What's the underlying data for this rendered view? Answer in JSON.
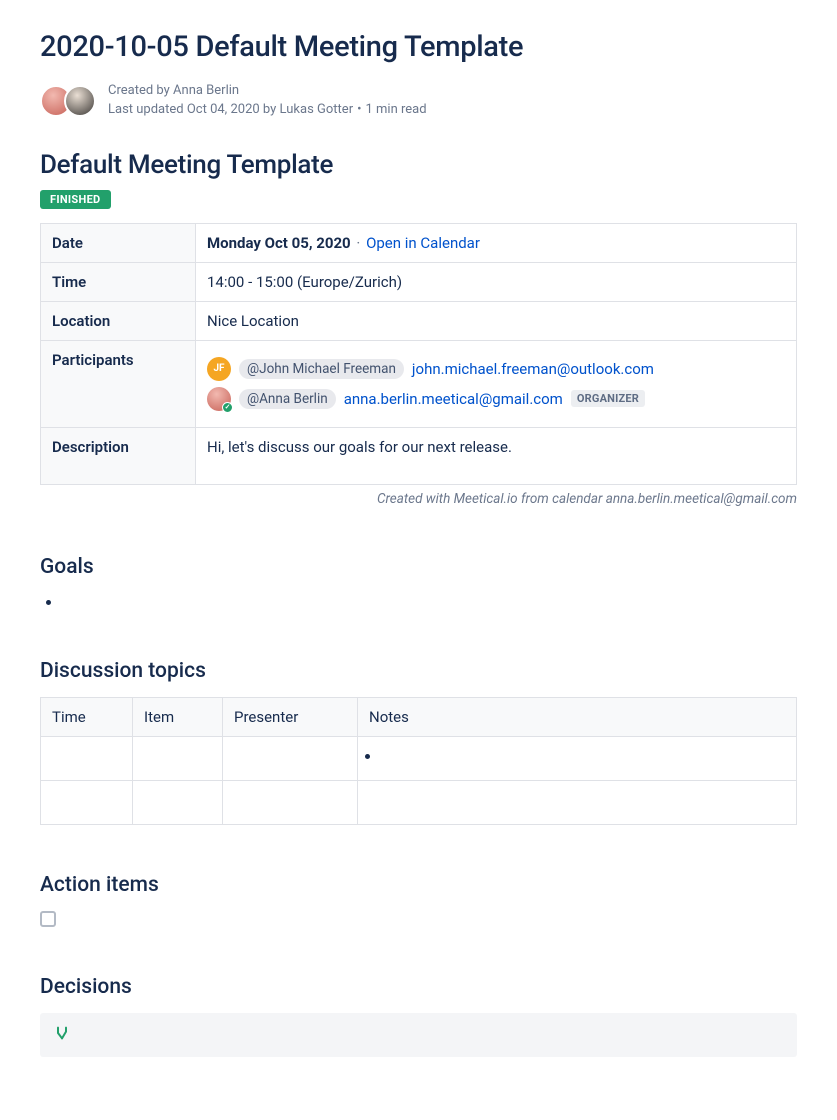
{
  "page": {
    "title": "2020-10-05 Default Meeting Template",
    "created_by_prefix": "Created by ",
    "created_by_name": "Anna Berlin",
    "updated_prefix": "Last updated ",
    "updated_date": "Oct 04, 2020",
    "updated_by_prefix": " by ",
    "updated_by_name": "Lukas Gotter",
    "read_time": "1 min read"
  },
  "meeting": {
    "heading": "Default Meeting Template",
    "status": "FINISHED",
    "labels": {
      "date": "Date",
      "time": "Time",
      "location": "Location",
      "participants": "Participants",
      "description": "Description"
    },
    "date_value": "Monday Oct 05, 2020",
    "open_in_calendar": "Open in Calendar",
    "time_value": "14:00 - 15:00 (Europe/Zurich)",
    "location_value": "Nice Location",
    "participants": [
      {
        "initials": "JF",
        "avatar_class": "jf",
        "mention": "@John Michael Freeman",
        "email": "john.michael.freeman@outlook.com",
        "organizer": false,
        "checked": false
      },
      {
        "initials": "",
        "avatar_class": "ab",
        "mention": "@Anna Berlin",
        "email": "anna.berlin.meetical@gmail.com",
        "organizer": true,
        "checked": true
      }
    ],
    "organizer_label": "ORGANIZER",
    "description_value": "Hi, let's discuss our goals for our next release.",
    "footer_note": "Created with Meetical.io from calendar anna.berlin.meetical@gmail.com"
  },
  "sections": {
    "goals_heading": "Goals",
    "discussion_heading": "Discussion topics",
    "action_heading": "Action items",
    "decisions_heading": "Decisions"
  },
  "topics_table": {
    "headers": {
      "time": "Time",
      "item": "Item",
      "presenter": "Presenter",
      "notes": "Notes"
    }
  }
}
